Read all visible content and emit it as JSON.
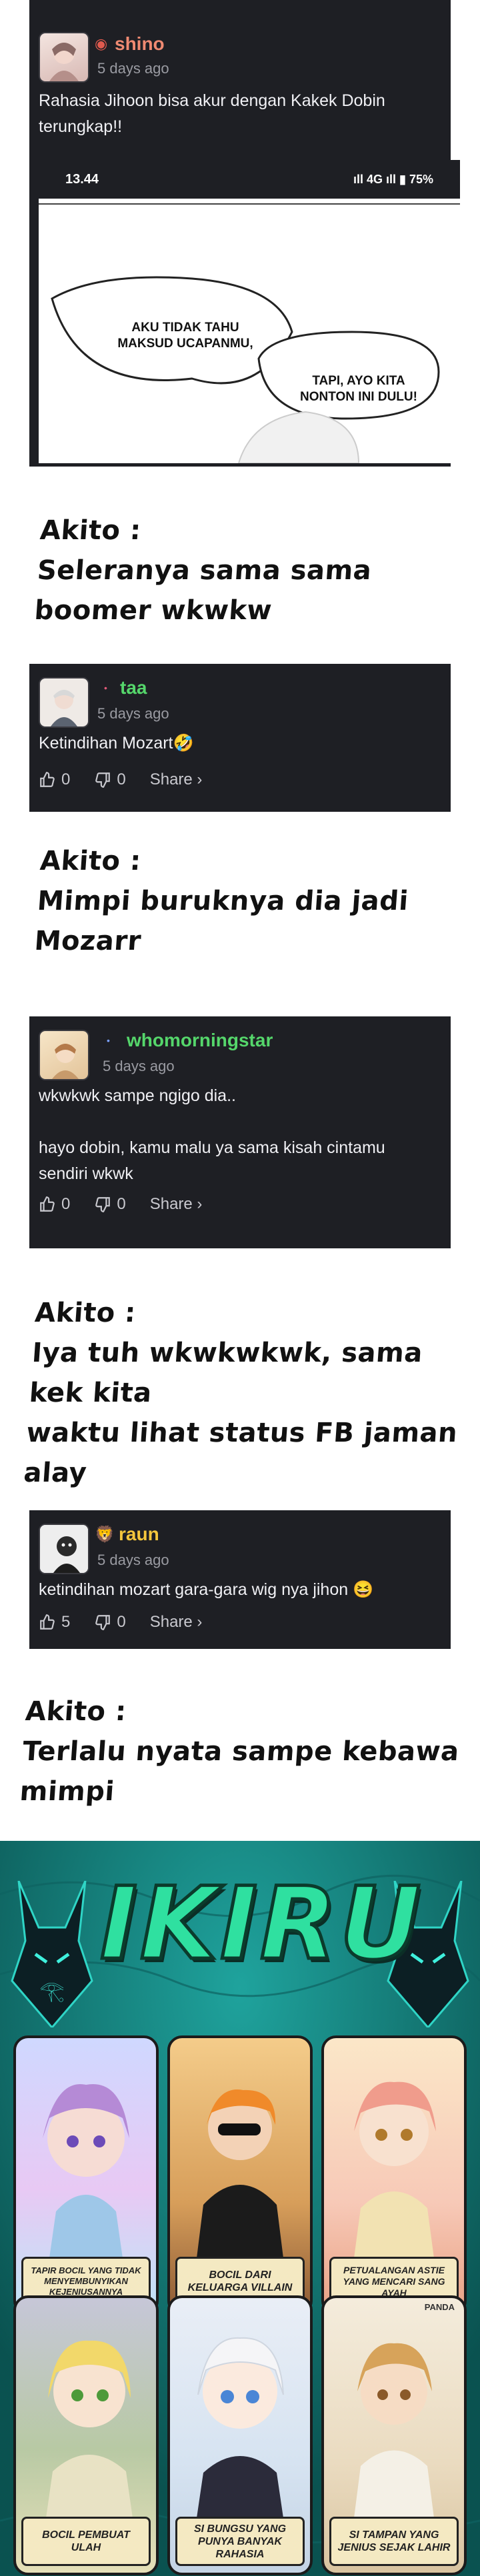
{
  "comments": [
    {
      "username": "shino",
      "username_color": "#f08a72",
      "time": "5 days ago",
      "body": "Rahasia Jihoon bisa akur dengan Kakek Dobin terungkap!!",
      "screenshot": {
        "clock": "13.44",
        "battery": "75%",
        "network": "4G",
        "bubble1": "AKU TIDAK TAHU MAKSUD UCAPANMU,",
        "bubble2": "TAPI, AYO KITA NONTON INI DULU!"
      }
    },
    {
      "username": "taa",
      "username_color": "#55d66b",
      "time": "5 days ago",
      "body": "Ketindihan Mozart🤣",
      "likes": "0",
      "dislikes": "0",
      "share_label": "Share ›"
    },
    {
      "username": "whomorningstar",
      "username_color": "#55d66b",
      "time": "5 days ago",
      "body": "wkwkwk sampe ngigo dia..\n\nhayo dobin, kamu malu ya sama kisah cintamu sendiri wkwk",
      "likes": "0",
      "dislikes": "0",
      "share_label": "Share ›"
    },
    {
      "username": "raun",
      "username_color": "#f4c63c",
      "time": "5 days ago",
      "body": "ketindihan mozart gara-gara wig nya jihon 😆",
      "likes": "5",
      "dislikes": "0",
      "share_label": "Share ›"
    }
  ],
  "replies": [
    {
      "author": "Akito :",
      "line1": "Seleranya sama sama",
      "line2": "boomer wkwkw"
    },
    {
      "author": "Akito :",
      "line1": "Mimpi buruknya dia jadi Mozarr",
      "line2": ""
    },
    {
      "author": "Akito :",
      "line1": "Iya tuh wkwkwkwk, sama kek kita",
      "line2": "waktu lihat status FB jaman alay"
    },
    {
      "author": "Akito :",
      "line1": "Terlalu nyata sampe kebawa mimpi",
      "line2": ""
    }
  ],
  "banner": {
    "title": "IKIRU",
    "watermark": "PANDA",
    "panels": [
      {
        "caption": "TAPIR BOCIL YANG TIDAK MENYEMBUNYIKAN KEJENIUSANNYA"
      },
      {
        "caption": "BOCIL DARI KELUARGA VILLAIN"
      },
      {
        "caption": "PETUALANGAN ASTIE YANG MENCARI SANG AYAH"
      },
      {
        "caption": "BOCIL PEMBUAT ULAH"
      },
      {
        "caption": "SI BUNGSU YANG PUNYA BANYAK RAHASIA"
      },
      {
        "caption": "SI TAMPAN YANG JENIUS SEJAK LAHIR"
      }
    ]
  },
  "colors": {
    "card_bg": "#1e1f24",
    "banner_bg": "#11706e"
  }
}
